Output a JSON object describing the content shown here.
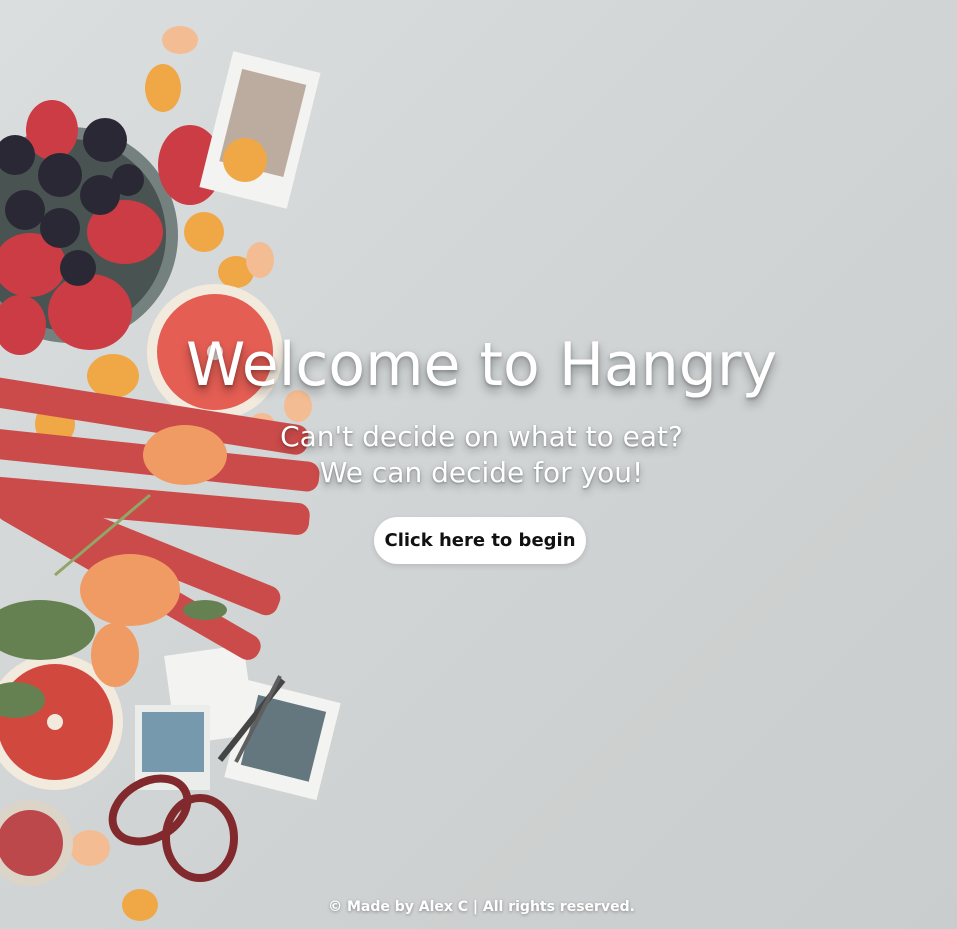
{
  "hero": {
    "title": "Welcome to Hangry",
    "subtitle_line1": "Can't decide on what to eat?",
    "subtitle_line2": "We can decide for you!",
    "cta_label": "Click here to begin"
  },
  "footer": {
    "text": "© Made by Alex C | All rights reserved."
  },
  "colors": {
    "text": "#ffffff",
    "button_bg": "#ffffff",
    "button_text": "#111111",
    "background": "#d3d6d6"
  }
}
